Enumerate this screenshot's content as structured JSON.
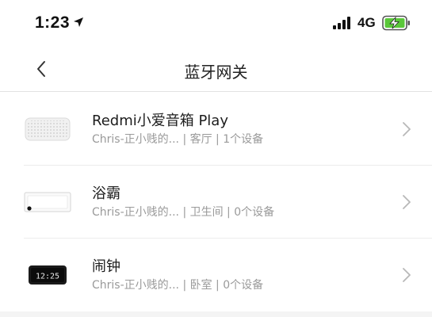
{
  "status_bar": {
    "time": "1:23",
    "network": "4G",
    "icons": [
      "location-arrow-icon",
      "signal-bars-icon",
      "battery-charging-icon"
    ]
  },
  "nav": {
    "title": "蓝牙网关",
    "back_icon": "back-chevron-icon"
  },
  "devices": [
    {
      "name": "Redmi小爱音箱 Play",
      "subtitle": "Chris-正小贱的... | 客厅 | 1个设备",
      "icon": "speaker-icon"
    },
    {
      "name": "浴霸",
      "subtitle": "Chris-正小贱的... | 卫生间 | 0个设备",
      "icon": "bath-heater-icon"
    },
    {
      "name": "闹钟",
      "subtitle": "Chris-正小贱的... | 卧室 | 0个设备",
      "icon": "alarm-clock-icon",
      "clock_face": "12:25"
    }
  ],
  "colors": {
    "battery_fill": "#5ac739",
    "background": "#f4f4f4",
    "subtitle": "#9a9a9a"
  }
}
